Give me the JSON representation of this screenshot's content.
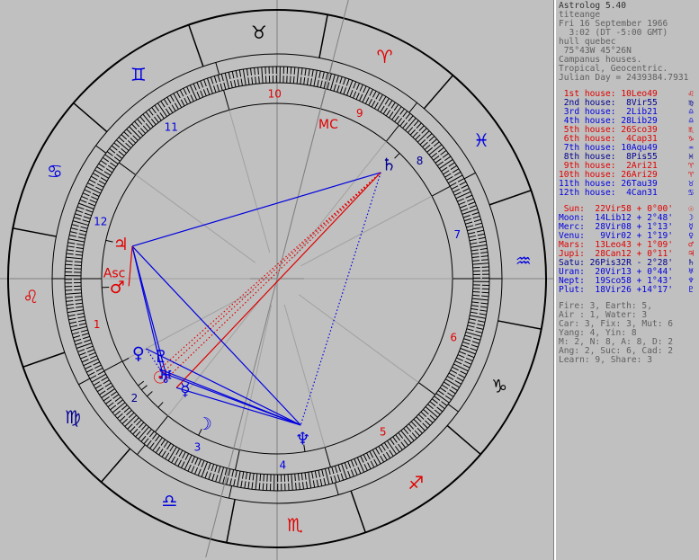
{
  "app_title": "Astrolog 5.40",
  "chart_info": [
    "titeange",
    "Fri 16 September 1966",
    "  3:02 (DT -5:00 GMT)",
    "hull quebec",
    " 75°43W 45°26N",
    "Campanus houses.",
    "Tropical, Geocentric.",
    "Julian Day = 2439384.7931"
  ],
  "colors": {
    "red": "#e00000",
    "blue": "#0000e0",
    "dark_blue": "#000090",
    "gray": "#606060",
    "background": "#c0c0c0"
  },
  "houses": [
    {
      "label": "1st house:",
      "value": "10Leo49",
      "sign_icon": "leo-icon",
      "glyph": "♌",
      "color": "#e00000"
    },
    {
      "label": "2nd house:",
      "value": " 8Vir55",
      "sign_icon": "virgo-icon",
      "glyph": "♍",
      "color": "#000090"
    },
    {
      "label": "3rd house:",
      "value": " 2Lib21",
      "sign_icon": "libra-icon",
      "glyph": "♎",
      "color": "#0000e0"
    },
    {
      "label": "4th house:",
      "value": "28Lib29",
      "sign_icon": "libra-icon",
      "glyph": "♎",
      "color": "#0000e0"
    },
    {
      "label": "5th house:",
      "value": "26Sco39",
      "sign_icon": "scorpio-icon",
      "glyph": "♏",
      "color": "#e00000"
    },
    {
      "label": "6th house:",
      "value": " 4Cap31",
      "sign_icon": "capricorn-icon",
      "glyph": "♑",
      "color": "#e00000"
    },
    {
      "label": "7th house:",
      "value": "10Aqu49",
      "sign_icon": "aquarius-icon",
      "glyph": "♒",
      "color": "#0000e0"
    },
    {
      "label": "8th house:",
      "value": " 8Pis55",
      "sign_icon": "pisces-icon",
      "glyph": "♓",
      "color": "#000090"
    },
    {
      "label": "9th house:",
      "value": " 2Ari21",
      "sign_icon": "aries-icon",
      "glyph": "♈",
      "color": "#e00000"
    },
    {
      "label": "10th house:",
      "value": "26Ari29",
      "sign_icon": "aries-icon",
      "glyph": "♈",
      "color": "#e00000"
    },
    {
      "label": "11th house:",
      "value": "26Tau39",
      "sign_icon": "taurus-icon",
      "glyph": "♉",
      "color": "#0000e0"
    },
    {
      "label": "12th house:",
      "value": " 4Can31",
      "sign_icon": "cancer-icon",
      "glyph": "♋",
      "color": "#0000e0"
    }
  ],
  "planets": [
    {
      "label": "Sun:",
      "pos": "22Vir58",
      "lat": "+ 0°00'",
      "icon": "sun-icon",
      "glyph": "☉",
      "color": "#e00000"
    },
    {
      "label": "Moon:",
      "pos": "14Lib12",
      "lat": "+ 2°48'",
      "icon": "moon-icon",
      "glyph": "☽",
      "color": "#0000e0"
    },
    {
      "label": "Merc:",
      "pos": "28Vir08",
      "lat": "+ 1°13'",
      "icon": "mercury-icon",
      "glyph": "☿",
      "color": "#0000e0"
    },
    {
      "label": "Venu:",
      "pos": " 9Vir02",
      "lat": "+ 1°19'",
      "icon": "venus-icon",
      "glyph": "♀",
      "color": "#0000e0"
    },
    {
      "label": "Mars:",
      "pos": "13Leo43",
      "lat": "+ 1°09'",
      "icon": "mars-icon",
      "glyph": "♂",
      "color": "#e00000"
    },
    {
      "label": "Jupi:",
      "pos": "28Can12",
      "lat": "+ 0°11'",
      "icon": "jupiter-icon",
      "glyph": "♃",
      "color": "#e00000"
    },
    {
      "label": "Satu:",
      "pos": "26Pis32R",
      "lat": "- 2°28'",
      "icon": "saturn-icon",
      "glyph": "♄",
      "color": "#000090"
    },
    {
      "label": "Uran:",
      "pos": "20Vir13",
      "lat": "+ 0°44'",
      "icon": "uranus-icon",
      "glyph": "♅",
      "color": "#0000e0"
    },
    {
      "label": "Nept:",
      "pos": "19Sco58",
      "lat": "+ 1°43'",
      "icon": "neptune-icon",
      "glyph": "♆",
      "color": "#0000e0"
    },
    {
      "label": "Plut:",
      "pos": "18Vir26",
      "lat": "+14°17'",
      "icon": "pluto-icon",
      "glyph": "♇",
      "color": "#0000e0"
    }
  ],
  "summary": [
    "Fire: 3, Earth: 5,",
    "Air : 1, Water: 3",
    "Car: 3, Fix: 3, Mut: 6",
    "Yang: 4, Yin: 8",
    "M: 2, N: 8, A: 8, D: 2",
    "Ang: 2, Suc: 6, Cad: 2",
    "Learn: 9, Share: 3"
  ],
  "wheel": {
    "ascendant_lon": 130.82,
    "house_cusps_lon": [
      130.82,
      158.92,
      182.35,
      208.48,
      236.65,
      274.52,
      310.82,
      338.92,
      2.35,
      26.48,
      56.65,
      94.52
    ],
    "house_numbers": [
      "1",
      "2",
      "3",
      "4",
      "5",
      "6",
      "7",
      "8",
      "9",
      "10",
      "11",
      "12"
    ],
    "signs": [
      {
        "name": "aries-icon",
        "glyph": "♈",
        "color": "#e00000"
      },
      {
        "name": "taurus-icon",
        "glyph": "♉",
        "color": "#000000"
      },
      {
        "name": "gemini-icon",
        "glyph": "♊",
        "color": "#0000e0"
      },
      {
        "name": "cancer-icon",
        "glyph": "♋",
        "color": "#0000e0"
      },
      {
        "name": "leo-icon",
        "glyph": "♌",
        "color": "#e00000"
      },
      {
        "name": "virgo-icon",
        "glyph": "♍",
        "color": "#000090"
      },
      {
        "name": "libra-icon",
        "glyph": "♎",
        "color": "#0000e0"
      },
      {
        "name": "scorpio-icon",
        "glyph": "♏",
        "color": "#e00000"
      },
      {
        "name": "sagittarius-icon",
        "glyph": "♐",
        "color": "#e00000"
      },
      {
        "name": "capricorn-icon",
        "glyph": "♑",
        "color": "#000000"
      },
      {
        "name": "aquarius-icon",
        "glyph": "♒",
        "color": "#0000e0"
      },
      {
        "name": "pisces-icon",
        "glyph": "♓",
        "color": "#0000e0"
      }
    ],
    "angle_labels": [
      {
        "text": "Asc",
        "lon": 130.82,
        "color": "#e00000",
        "name": "ascendant-label"
      },
      {
        "text": "MC",
        "lon": 26.48,
        "color": "#e00000",
        "name": "midheaven-label"
      }
    ],
    "planet_positions": [
      {
        "name": "sun-icon",
        "glyph": "☉",
        "lon": 172.97,
        "color": "#e00000"
      },
      {
        "name": "moon-icon",
        "glyph": "☽",
        "lon": 194.2,
        "color": "#0000e0"
      },
      {
        "name": "mercury-icon",
        "glyph": "☿",
        "lon": 178.13,
        "color": "#0000e0"
      },
      {
        "name": "venus-icon",
        "glyph": "♀",
        "lon": 159.03,
        "color": "#0000e0"
      },
      {
        "name": "mars-icon",
        "glyph": "♂",
        "lon": 133.72,
        "color": "#e00000"
      },
      {
        "name": "jupiter-icon",
        "glyph": "♃",
        "lon": 118.2,
        "color": "#e00000"
      },
      {
        "name": "saturn-icon",
        "glyph": "♄",
        "lon": 356.53,
        "color": "#000090"
      },
      {
        "name": "uranus-icon",
        "glyph": "♅",
        "lon": 170.22,
        "color": "#0000e0"
      },
      {
        "name": "neptune-icon",
        "glyph": "♆",
        "lon": 229.97,
        "color": "#0000e0"
      },
      {
        "name": "pluto-icon",
        "glyph": "♇",
        "lon": 168.43,
        "color": "#0000e0"
      }
    ],
    "aspect_lines": [
      {
        "from": "jupiter-icon",
        "to": "saturn-icon",
        "color": "#0000e0",
        "style": "solid"
      },
      {
        "from": "jupiter-icon",
        "to": "sun-icon",
        "color": "#0000e0",
        "style": "solid"
      },
      {
        "from": "saturn-icon",
        "to": "pluto-icon",
        "color": "#e00000",
        "style": "dotted"
      },
      {
        "from": "saturn-icon",
        "to": "uranus-icon",
        "color": "#e00000",
        "style": "dotted"
      },
      {
        "from": "saturn-icon",
        "to": "sun-icon",
        "color": "#e00000",
        "style": "dotted"
      },
      {
        "from": "saturn-icon",
        "to": "mercury-icon",
        "color": "#e00000",
        "style": "solid"
      },
      {
        "from": "saturn-icon",
        "to": "neptune-icon",
        "color": "#0000e0",
        "style": "dotted"
      },
      {
        "from": "venus-icon",
        "to": "neptune-icon",
        "color": "#0000e0",
        "style": "solid"
      },
      {
        "from": "pluto-icon",
        "to": "neptune-icon",
        "color": "#0000e0",
        "style": "solid"
      },
      {
        "from": "uranus-icon",
        "to": "neptune-icon",
        "color": "#0000e0",
        "style": "solid"
      },
      {
        "from": "jupiter-icon",
        "to": "neptune-icon",
        "color": "#0000e0",
        "style": "solid"
      },
      {
        "from": "mercury-icon",
        "to": "neptune-icon",
        "color": "#0000e0",
        "style": "solid"
      },
      {
        "from": "venus-icon",
        "to": "uranus-icon",
        "color": "#0000e0",
        "style": "dotted"
      },
      {
        "from": "jupiter-icon",
        "to": "uranus-icon",
        "color": "#0000e0",
        "style": "solid"
      },
      {
        "from": "mars-icon",
        "to": "jupiter-icon",
        "color": "#e00000",
        "style": "solid"
      }
    ]
  }
}
